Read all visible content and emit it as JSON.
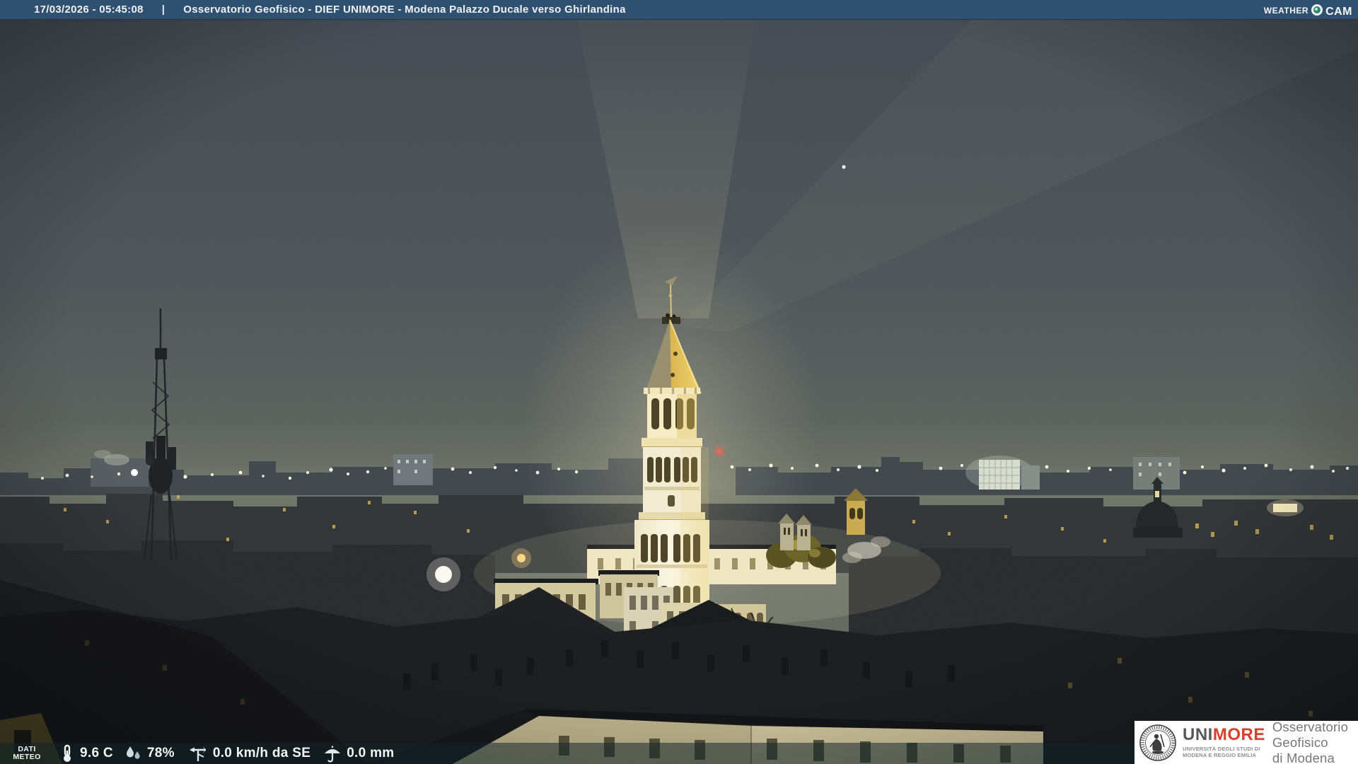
{
  "header": {
    "datetime": "17/03/2026 - 05:45:08",
    "separator": "|",
    "title": "Osservatorio Geofisico - DIEF UNIMORE - Modena Palazzo Ducale verso Ghirlandina",
    "logo": {
      "weather": "Weather",
      "cam": "Cam",
      "lens_icon": "camera-lens-icon"
    }
  },
  "weather_bar": {
    "label_line1": "DATI",
    "label_line2": "METEO",
    "metrics": {
      "temperature": {
        "value": "9.6 C",
        "icon": "thermometer-icon"
      },
      "humidity": {
        "value": "78%",
        "icon": "humidity-drops-icon"
      },
      "wind": {
        "value": "0.0 km/h da SE",
        "icon": "wind-vane-icon"
      },
      "rain": {
        "value": "0.0 mm",
        "icon": "rain-umbrella-icon"
      }
    }
  },
  "branding": {
    "acronym_gray": "UNI",
    "acronym_red": "MORE",
    "university_line1": "UNIVERSITÀ DEGLI STUDI DI",
    "university_line2": "MODENA E REGGIO EMILIA",
    "observatory_line1": "Osservatorio Geofisico",
    "observatory_line2": "di Modena",
    "seal_icon": "unimore-seal-icon"
  },
  "colors": {
    "header_bg": "#30506f",
    "header_text": "#eef2f5",
    "weather_bar_bg": "rgba(16,36,42,0.52)",
    "unimore_red": "#d9402c",
    "unimore_gray": "#58585a",
    "sky_top": "#434a52",
    "sky_horizon": "#71766a",
    "tower_light": "#f6eecb",
    "spire_gold": "#e9cb5f"
  },
  "scene_landmarks": [
    "ghirlandina-tower",
    "palazzo-ducale-district",
    "antenna-mast",
    "city-skyline",
    "morning-star"
  ]
}
